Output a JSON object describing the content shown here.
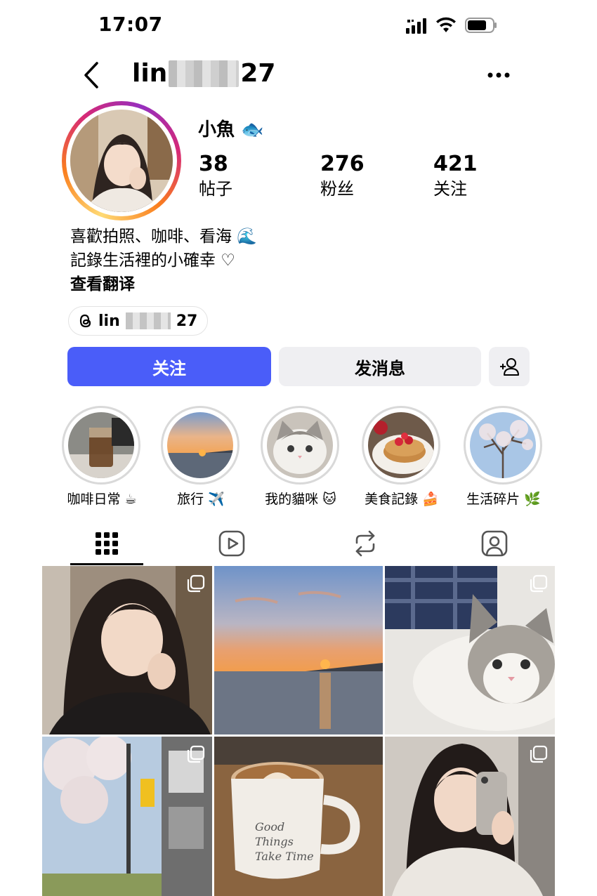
{
  "status": {
    "time": "17:07"
  },
  "header": {
    "username_prefix": "lin",
    "username_suffix": "27"
  },
  "profile": {
    "display_name": "小魚 🐟",
    "stats": [
      {
        "value": "38",
        "label": "帖子"
      },
      {
        "value": "276",
        "label": "粉丝"
      },
      {
        "value": "421",
        "label": "关注"
      }
    ],
    "bio": [
      "喜歡拍照、咖啡、看海 🌊",
      "記錄生活裡的小確幸 ♡"
    ],
    "translate_label": "查看翻译",
    "threads_prefix": "lin",
    "threads_suffix": "27"
  },
  "actions": {
    "follow_label": "关注",
    "message_label": "发消息"
  },
  "highlights": [
    {
      "label": "咖啡日常 ☕",
      "icon": "coffee-cup"
    },
    {
      "label": "旅行 ✈️",
      "icon": "sunset-sea"
    },
    {
      "label": "我的貓咪 🐱",
      "icon": "cat"
    },
    {
      "label": "美食記錄 🍰",
      "icon": "pancakes"
    },
    {
      "label": "生活碎片 🌿",
      "icon": "cherry-blossom"
    }
  ],
  "tabs": [
    {
      "name": "posts",
      "icon": "grid-icon",
      "active": true
    },
    {
      "name": "reels",
      "icon": "reels-icon",
      "active": false
    },
    {
      "name": "reposts",
      "icon": "repost-icon",
      "active": false
    },
    {
      "name": "tagged",
      "icon": "tagged-icon",
      "active": false
    }
  ],
  "posts": [
    {
      "subject": "selfie",
      "multi": true
    },
    {
      "subject": "sunset",
      "multi": false
    },
    {
      "subject": "cat",
      "multi": true
    },
    {
      "subject": "street-cherry-blossom",
      "multi": true
    },
    {
      "subject": "latte",
      "mug_text": "Good Things Take Time",
      "multi": false
    },
    {
      "subject": "mirror-selfie",
      "multi": true
    }
  ],
  "colors": {
    "accent": "#4a5df9",
    "secondary_button": "#efeff2",
    "text": "#000000"
  }
}
